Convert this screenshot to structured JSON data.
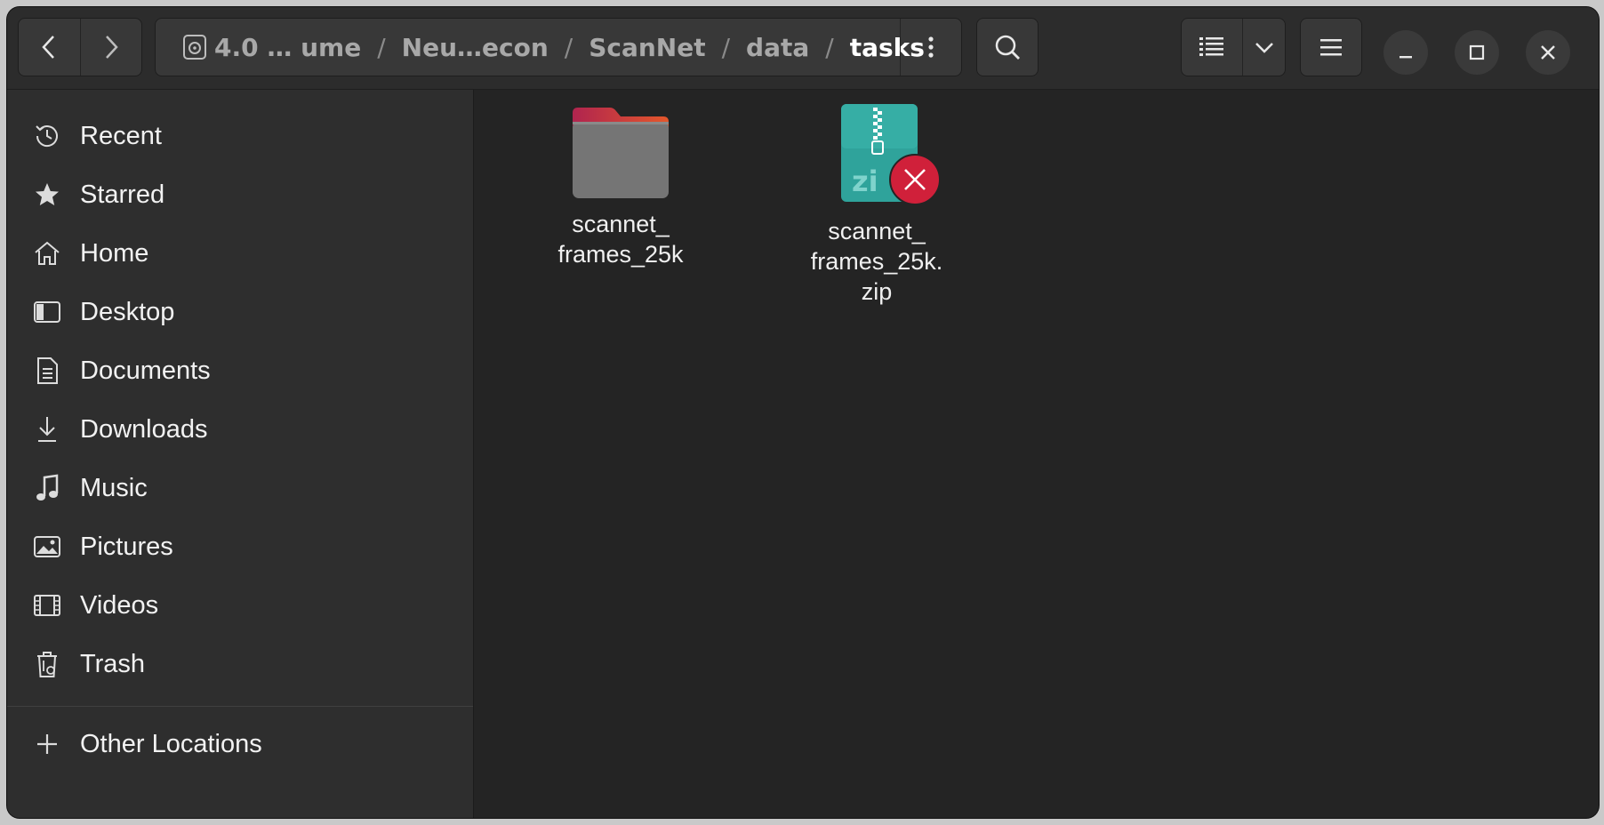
{
  "header": {
    "path": [
      {
        "label": "4.0 …   ume"
      },
      {
        "label": "Neu…econ"
      },
      {
        "label": "ScanNet"
      },
      {
        "label": "data"
      },
      {
        "label": "tasks"
      }
    ],
    "separator": "/",
    "icons": {
      "back": "chevron-left-icon",
      "forward": "chevron-right-icon",
      "drive": "drive-icon",
      "path_menu": "vertical-dots-icon",
      "search": "search-icon",
      "view_list": "list-view-icon",
      "view_options": "chevron-down-icon",
      "main_menu": "hamburger-icon",
      "minimize": "minimize-icon",
      "maximize": "maximize-icon",
      "close": "close-icon"
    }
  },
  "sidebar": {
    "items": [
      {
        "label": "Recent",
        "icon": "clock-icon"
      },
      {
        "label": "Starred",
        "icon": "star-icon"
      },
      {
        "label": "Home",
        "icon": "home-icon"
      },
      {
        "label": "Desktop",
        "icon": "desktop-icon"
      },
      {
        "label": "Documents",
        "icon": "document-icon"
      },
      {
        "label": "Downloads",
        "icon": "download-icon"
      },
      {
        "label": "Music",
        "icon": "music-icon"
      },
      {
        "label": "Pictures",
        "icon": "picture-icon"
      },
      {
        "label": "Videos",
        "icon": "video-icon"
      },
      {
        "label": "Trash",
        "icon": "trash-icon"
      }
    ],
    "partial_item": {
      "label": "Other Locations",
      "icon": "plus-icon"
    }
  },
  "files": [
    {
      "name": "scannet_\nframes_25k",
      "type": "folder",
      "icon": "folder-icon"
    },
    {
      "name": "scannet_\nframes_25k.\nzip",
      "type": "zip",
      "icon": "zip-archive-icon",
      "emblem": "unreadable-emblem-icon"
    }
  ],
  "colors": {
    "folder_tab_start": "#c2325a",
    "folder_tab_end": "#e9642a",
    "folder_body": "#7a7a7a",
    "zip_body": "#2fa39b",
    "emblem": "#d0203a"
  }
}
